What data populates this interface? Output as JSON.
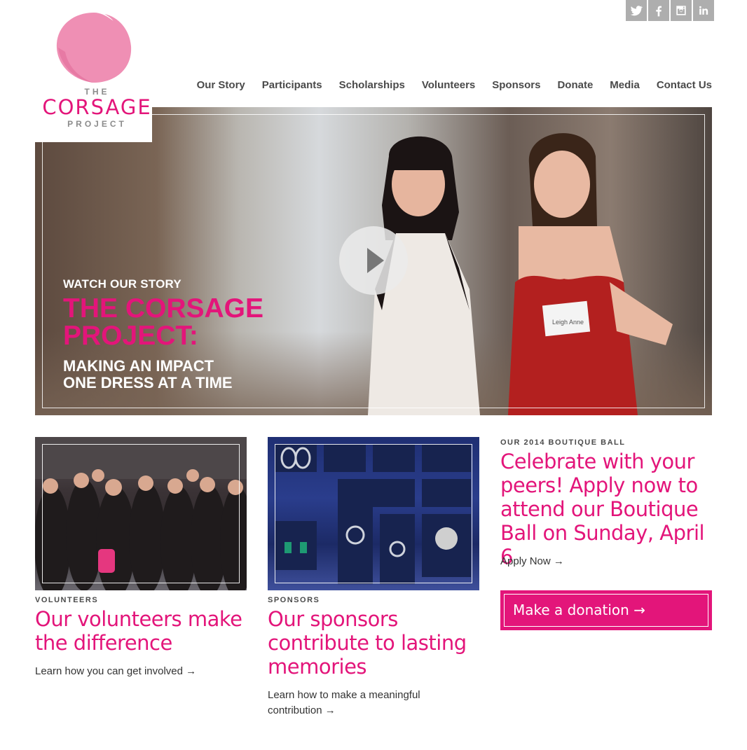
{
  "social": [
    "twitter-icon",
    "facebook-icon",
    "instagram-icon",
    "linkedin-icon"
  ],
  "logo": {
    "line1": "THE",
    "line2": "CORSAGE",
    "line3": "PROJECT"
  },
  "nav": {
    "our_story": "Our Story",
    "participants": "Participants",
    "scholarships": "Scholarships",
    "volunteers": "Volunteers",
    "sponsors": "Sponsors",
    "donate": "Donate",
    "media": "Media",
    "contact_us": "Contact Us"
  },
  "hero": {
    "watch": "WATCH OUR STORY",
    "title": "THE CORSAGE PROJECT:",
    "subtitle_line1": "MAKING AN IMPACT",
    "subtitle_line2": "ONE DRESS AT A TIME",
    "badge": "Leigh Anne"
  },
  "volunteers": {
    "kicker": "VOLUNTEERS",
    "headline": "Our volunteers make the difference",
    "link": "Learn how you can get involved →"
  },
  "sponsors": {
    "kicker": "SPONSORS",
    "headline": "Our sponsors contribute to lasting memories",
    "link": "Learn how to make a meaningful contribution →"
  },
  "ball": {
    "kicker": "OUR 2014 BOUTIQUE BALL",
    "headline": "Celebrate with your peers! Apply now to attend our Boutique Ball on Sunday, April 6",
    "link": "Apply Now →"
  },
  "donate": {
    "label": "Make a donation  →"
  },
  "colors": {
    "brand_pink": "#e3157a",
    "logo_pink": "#ef8fb4",
    "gray": "#aeaeae"
  }
}
